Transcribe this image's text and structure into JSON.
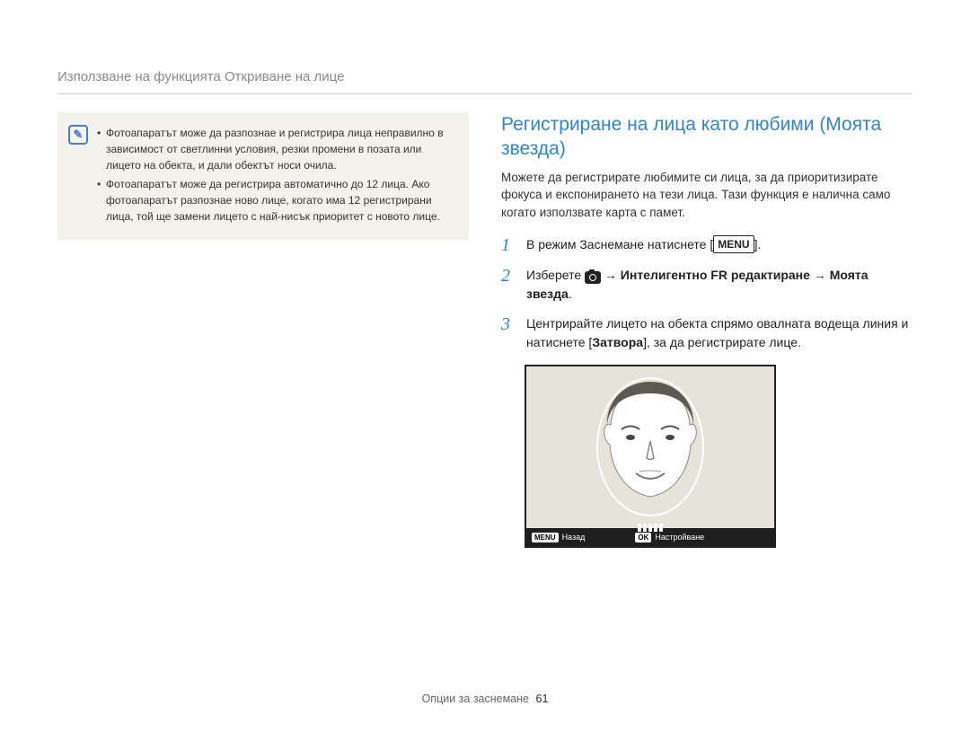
{
  "header": {
    "title": "Използване на функцията Откриване на лице"
  },
  "note": {
    "icon_glyph": "✎",
    "items": [
      "Фотоапаратът може да разпознае и регистрира лица неправилно в зависимост от светлинни условия, резки промени в позата или лицето на обекта, и дали обектът носи очила.",
      "Фотоапаратът може да регистрира автоматично до 12 лица. Ако фотоапаратът разпознае ново лице, когато има 12 регистрирани лица, той ще замени лицето с най-нисък приоритет с новото лице."
    ]
  },
  "section": {
    "title": "Регистриране на лица като любими (Моята звезда)",
    "intro": "Можете да регистрирате любимите си лица, за да приоритизирате фокуса и експонирането на тези лица. Тази функция е налична само когато използвате карта с памет."
  },
  "steps": [
    {
      "num": "1",
      "pre": "В режим Заснемане натиснете ",
      "menu_key": "MENU",
      "post": "."
    },
    {
      "num": "2",
      "pre": "Изберете ",
      "camera_icon": true,
      "arrow1": " → ",
      "bold1": "Интелигентно FR редактиране",
      "arrow2": " → ",
      "bold2": "Моята звезда",
      "post": "."
    },
    {
      "num": "3",
      "pre": "Центрирайте лицето на обекта спрямо овалната водеща линия и натиснете [",
      "bold1": "Затвора",
      "post": "], за да регистрирате лице."
    }
  ],
  "camera_ui": {
    "key_menu": "MENU",
    "label_back": "Назад",
    "key_ok": "OK",
    "label_set": "Настройване"
  },
  "footer": {
    "label": "Опции за заснемане",
    "page": "61"
  }
}
